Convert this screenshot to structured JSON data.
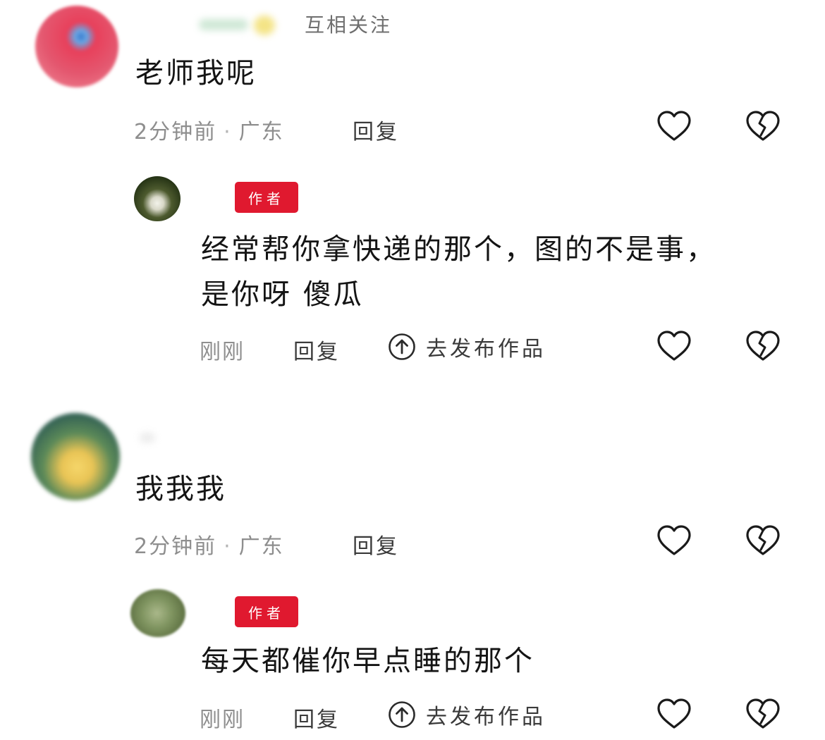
{
  "comments": [
    {
      "follow_tag": "互相关注",
      "text": "老师我呢",
      "time": "2分钟前",
      "location": "广东",
      "reply_label": "回复",
      "reply": {
        "badge": "作者",
        "text_line1": "经常帮你拿快递的那个，图的不是事，",
        "text_line2": "是你呀 傻瓜",
        "time": "刚刚",
        "reply_label": "回复",
        "publish_label": "去发布作品"
      }
    },
    {
      "text": "我我我",
      "time": "2分钟前",
      "location": "广东",
      "reply_label": "回复",
      "reply": {
        "badge": "作者",
        "text_line1": "每天都催你早点睡的那个",
        "time": "刚刚",
        "reply_label": "回复",
        "publish_label": "去发布作品"
      }
    }
  ],
  "icons": {
    "like": "heart-outline-icon",
    "dislike": "broken-heart-icon",
    "publish": "arrow-up-circle-icon"
  },
  "colors": {
    "author_badge": "#e0192f",
    "meta_text": "#8e8e8e"
  }
}
